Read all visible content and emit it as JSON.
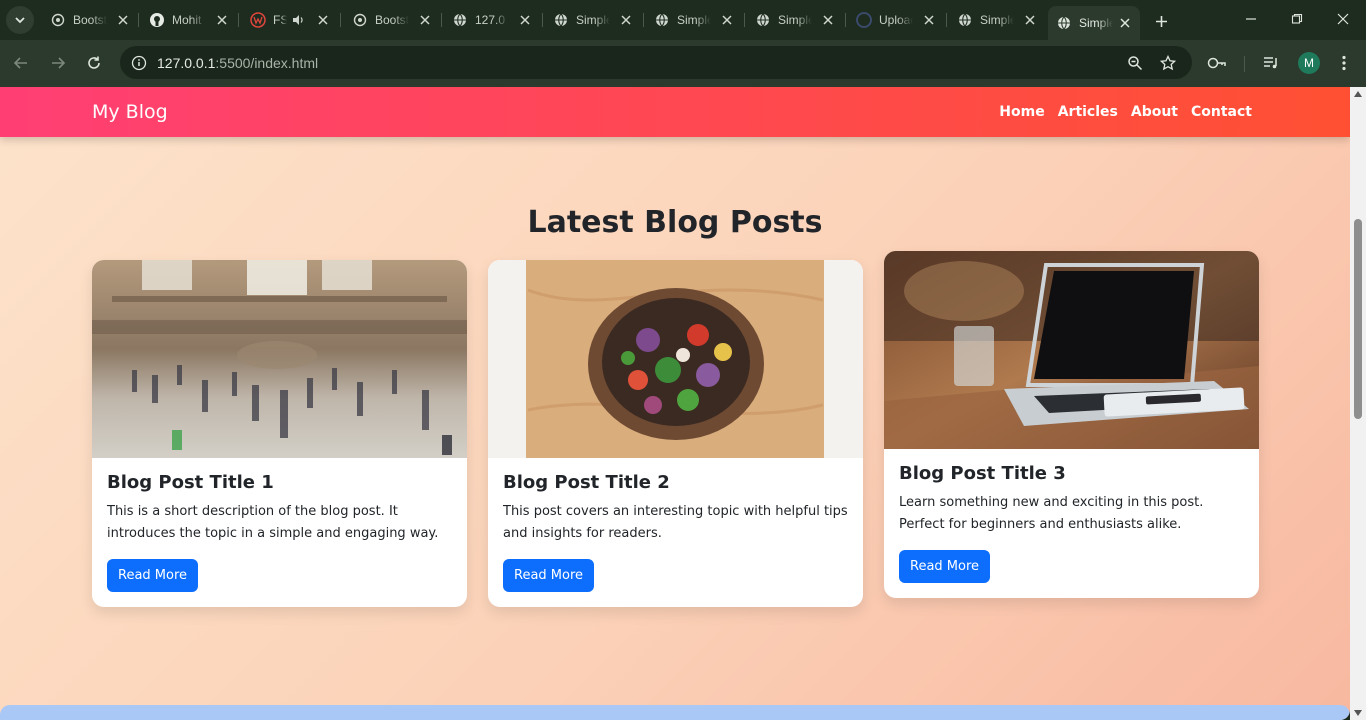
{
  "browser": {
    "tabs": [
      {
        "title": "Bootstrap",
        "icon": "openai-icon"
      },
      {
        "title": "Mohit",
        "icon": "github-icon"
      },
      {
        "title": "FS",
        "icon": "w-logo-icon",
        "audio": true
      },
      {
        "title": "Bootstrap",
        "icon": "openai-icon"
      },
      {
        "title": "127.0",
        "icon": "globe-icon"
      },
      {
        "title": "Simple",
        "icon": "globe-icon"
      },
      {
        "title": "Simple",
        "icon": "globe-icon"
      },
      {
        "title": "Simple",
        "icon": "globe-icon"
      },
      {
        "title": "Upload",
        "icon": "github-icon"
      },
      {
        "title": "Simple",
        "icon": "globe-icon"
      },
      {
        "title": "Simple",
        "icon": "globe-icon",
        "active": true
      }
    ],
    "url_host": "127.0.0.1",
    "url_path": ":5500/index.html",
    "profile_initial": "M"
  },
  "site": {
    "brand": "My Blog",
    "nav": [
      "Home",
      "Articles",
      "About",
      "Contact"
    ],
    "heading": "Latest Blog Posts",
    "posts": [
      {
        "title": "Blog Post Title 1",
        "desc": "This is a short description of the blog post. It introduces the topic in a simple and engaging way.",
        "button": "Read More",
        "image": "train-station-crowd"
      },
      {
        "title": "Blog Post Title 2",
        "desc": "This post covers an interesting topic with helpful tips and insights for readers.",
        "button": "Read More",
        "image": "salad-bowl"
      },
      {
        "title": "Blog Post Title 3",
        "desc": "Learn something new and exciting in this post. Perfect for beginners and enthusiasts alike.",
        "button": "Read More",
        "image": "laptop-on-desk"
      }
    ]
  },
  "colors": {
    "nav_gradient_start": "#ff3f74",
    "nav_gradient_end": "#ff5033",
    "button_blue": "#0d6efd",
    "page_bg": "#fde3cb"
  }
}
